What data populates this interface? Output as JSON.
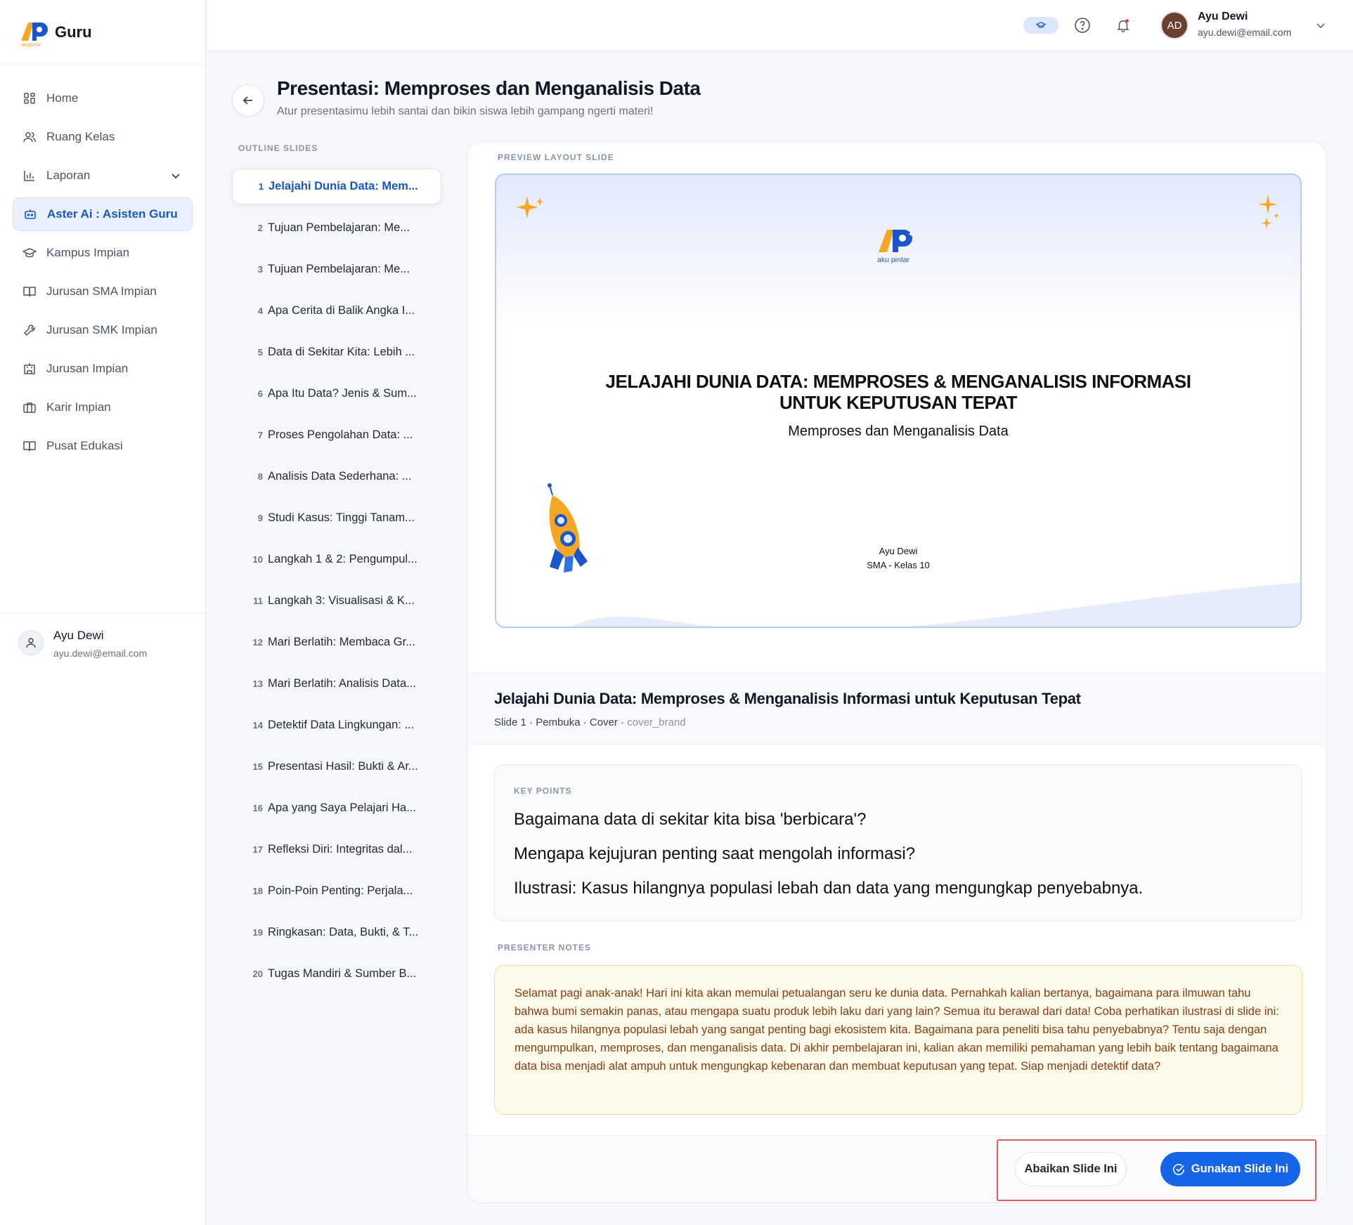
{
  "app": {
    "logo_text": "AP",
    "logo_sub": "akupintar",
    "title": "Guru"
  },
  "sidebar": {
    "items": [
      {
        "label": "Home",
        "icon": "grid-icon"
      },
      {
        "label": "Ruang Kelas",
        "icon": "users-icon"
      },
      {
        "label": "Laporan",
        "icon": "bar-chart-icon"
      },
      {
        "label": "Aster Ai : Asisten Guru",
        "icon": "robot-icon"
      },
      {
        "label": "Kampus Impian",
        "icon": "graduation-cap-icon"
      },
      {
        "label": "Jurusan SMA Impian",
        "icon": "book-icon"
      },
      {
        "label": "Jurusan SMK Impian",
        "icon": "wrench-icon"
      },
      {
        "label": "Jurusan Impian",
        "icon": "building-icon"
      },
      {
        "label": "Karir Impian",
        "icon": "briefcase-icon"
      },
      {
        "label": "Pusat Edukasi",
        "icon": "book-open-icon"
      }
    ],
    "user": {
      "name": "Ayu Dewi",
      "email": "ayu.dewi@email.com"
    }
  },
  "topbar": {
    "avatar_initials": "AD",
    "user_name": "Ayu Dewi",
    "user_email": "ayu.dewi@email.com"
  },
  "page": {
    "title": "Presentasi: Memproses dan Menganalisis Data",
    "subtitle": "Atur presentasimu lebih santai dan bikin siswa lebih gampang ngerti materi!"
  },
  "outline": {
    "label": "OUTLINE SLIDES",
    "items": [
      {
        "num": "1",
        "title": "Jelajahi Dunia Data: Mem..."
      },
      {
        "num": "2",
        "title": "Tujuan Pembelajaran: Me..."
      },
      {
        "num": "3",
        "title": "Tujuan Pembelajaran: Me..."
      },
      {
        "num": "4",
        "title": "Apa Cerita di Balik Angka I..."
      },
      {
        "num": "5",
        "title": "Data di Sekitar Kita: Lebih ..."
      },
      {
        "num": "6",
        "title": "Apa Itu Data? Jenis & Sum..."
      },
      {
        "num": "7",
        "title": "Proses Pengolahan Data: ..."
      },
      {
        "num": "8",
        "title": "Analisis Data Sederhana: ..."
      },
      {
        "num": "9",
        "title": "Studi Kasus: Tinggi Tanam..."
      },
      {
        "num": "10",
        "title": "Langkah 1 & 2: Pengumpul..."
      },
      {
        "num": "11",
        "title": "Langkah 3: Visualisasi & K..."
      },
      {
        "num": "12",
        "title": "Mari Berlatih: Membaca Gr..."
      },
      {
        "num": "13",
        "title": "Mari Berlatih: Analisis Data..."
      },
      {
        "num": "14",
        "title": "Detektif Data Lingkungan: ..."
      },
      {
        "num": "15",
        "title": "Presentasi Hasil: Bukti & Ar..."
      },
      {
        "num": "16",
        "title": "Apa yang Saya Pelajari Ha..."
      },
      {
        "num": "17",
        "title": "Refleksi Diri: Integritas dal..."
      },
      {
        "num": "18",
        "title": "Poin-Poin Penting: Perjala..."
      },
      {
        "num": "19",
        "title": "Ringkasan: Data, Bukti, & T..."
      },
      {
        "num": "20",
        "title": "Tugas Mandiri & Sumber B..."
      }
    ]
  },
  "preview": {
    "label": "PREVIEW LAYOUT SLIDE",
    "slide_logo_sub": "aku pintar",
    "slide_title_line1": "JELAJAHI DUNIA DATA: MEMPROSES & MENGANALISIS INFORMASI",
    "slide_title_line2": "UNTUK KEPUTUSAN TEPAT",
    "slide_subtitle": "Memproses dan Menganalisis Data",
    "slide_author": "Ayu Dewi",
    "slide_class": "SMA - Kelas 10"
  },
  "slide_info": {
    "title": "Jelajahi Dunia Data: Memproses & Menganalisis Informasi untuk Keputusan Tepat",
    "meta": "Slide 1 · Pembuka · Cover ·",
    "layout": "cover_brand"
  },
  "key_points": {
    "label": "KEY POINTS",
    "items": [
      "Bagaimana data di sekitar kita bisa 'berbicara'?",
      "Mengapa kejujuran penting saat mengolah informasi?",
      "Ilustrasi: Kasus hilangnya populasi lebah dan data yang mengungkap penyebabnya."
    ]
  },
  "presenter_notes": {
    "label": "PRESENTER NOTES",
    "text": "Selamat pagi anak-anak! Hari ini kita akan memulai petualangan seru ke dunia data. Pernahkah kalian bertanya, bagaimana para ilmuwan tahu bahwa bumi semakin panas, atau mengapa suatu produk lebih laku dari yang lain? Semua itu berawal dari data! Coba perhatikan ilustrasi di slide ini: ada kasus hilangnya populasi lebah yang sangat penting bagi ekosistem kita. Bagaimana para peneliti bisa tahu penyebabnya? Tentu saja dengan mengumpulkan, memproses, dan menganalisis data. Di akhir pembelajaran ini, kalian akan memiliki pemahaman yang lebih baik tentang bagaimana data bisa menjadi alat ampuh untuk mengungkap kebenaran dan membuat keputusan yang tepat. Siap menjadi detektif data?"
  },
  "actions": {
    "ignore_label": "Abaikan Slide Ini",
    "use_label": "Gunakan Slide Ini"
  },
  "colors": {
    "accent": "#1565e6",
    "active_bg": "#eaf1fe",
    "notes_bg": "#fffbea",
    "notes_text": "#8a3b12",
    "logo_orange": "#f5a623",
    "logo_blue": "#1a56c9"
  }
}
